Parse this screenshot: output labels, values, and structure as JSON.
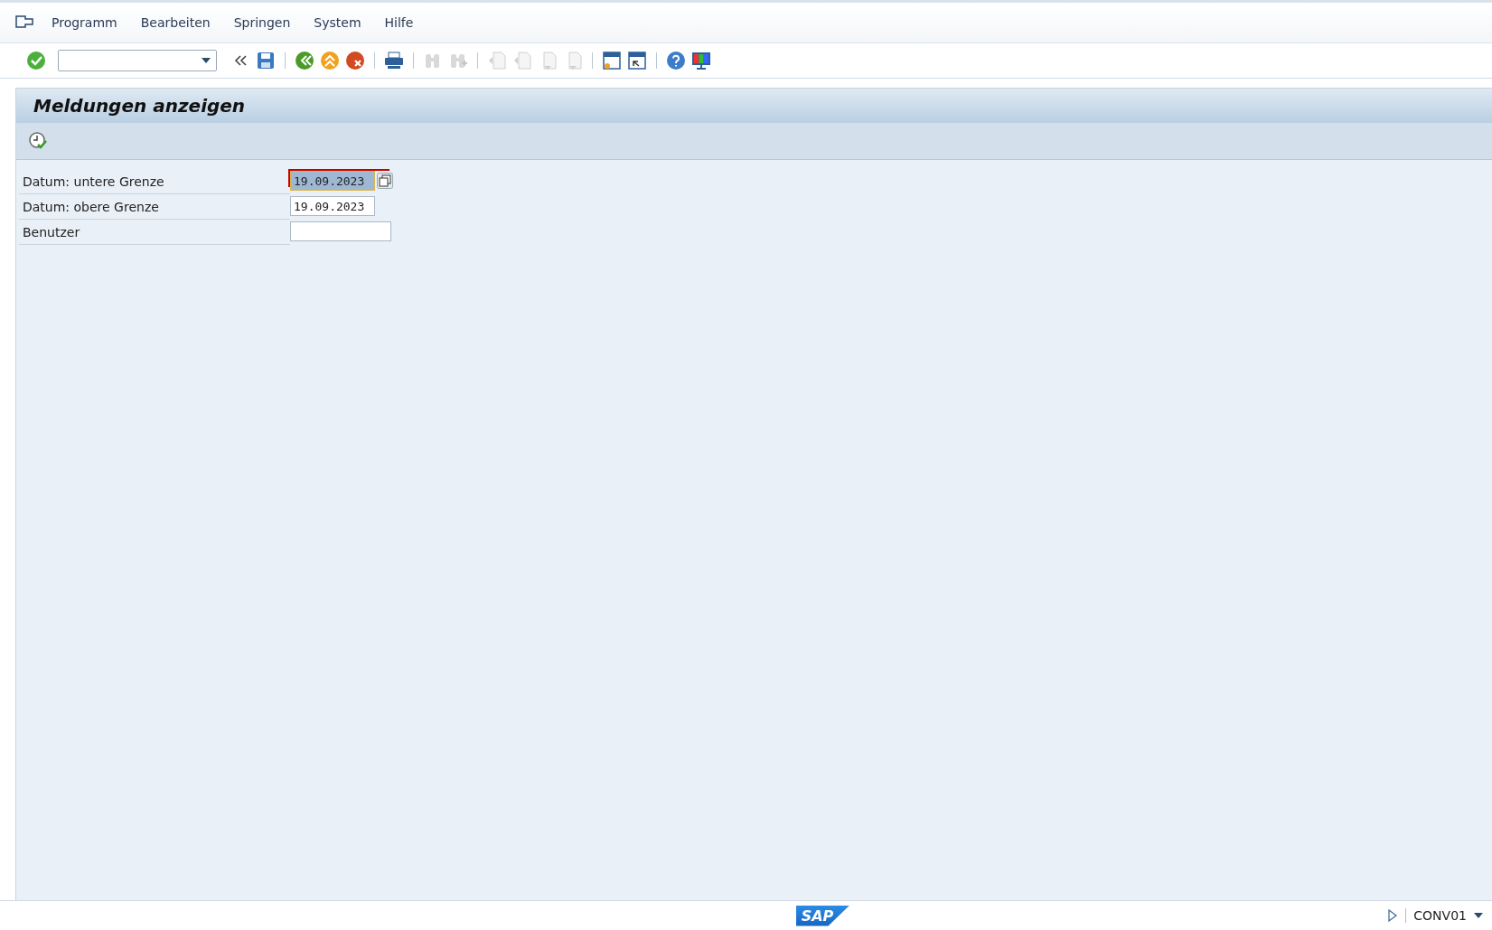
{
  "menu": [
    {
      "label": "Programm"
    },
    {
      "label": "Bearbeiten"
    },
    {
      "label": "Springen"
    },
    {
      "label": "System"
    },
    {
      "label": "Hilfe"
    }
  ],
  "toolbar_buttons": [
    {
      "disabled": false
    },
    {
      "disabled": false
    },
    {
      "disabled": false
    },
    {
      "disabled": false
    },
    {
      "disabled": false
    },
    {
      "disabled": false
    },
    {
      "disabled": false
    },
    {
      "disabled": true
    },
    {
      "disabled": true
    },
    {
      "disabled": true
    },
    {
      "disabled": true
    },
    {
      "disabled": true
    },
    {
      "disabled": true
    },
    {
      "disabled": false
    },
    {
      "disabled": false
    },
    {
      "disabled": false
    },
    {
      "disabled": false
    }
  ],
  "title": "Meldungen anzeigen",
  "fields": [
    {
      "label": "Datum: untere Grenze",
      "kind": "date",
      "value": "19.09.2023",
      "focused": true
    },
    {
      "label": "Datum: obere Grenze",
      "kind": "date",
      "value": "19.09.2023",
      "focused": false
    },
    {
      "label": "Benutzer",
      "kind": "text",
      "focused": false
    }
  ],
  "status_bar": {
    "logo": "SAP",
    "system": "CONV01"
  }
}
